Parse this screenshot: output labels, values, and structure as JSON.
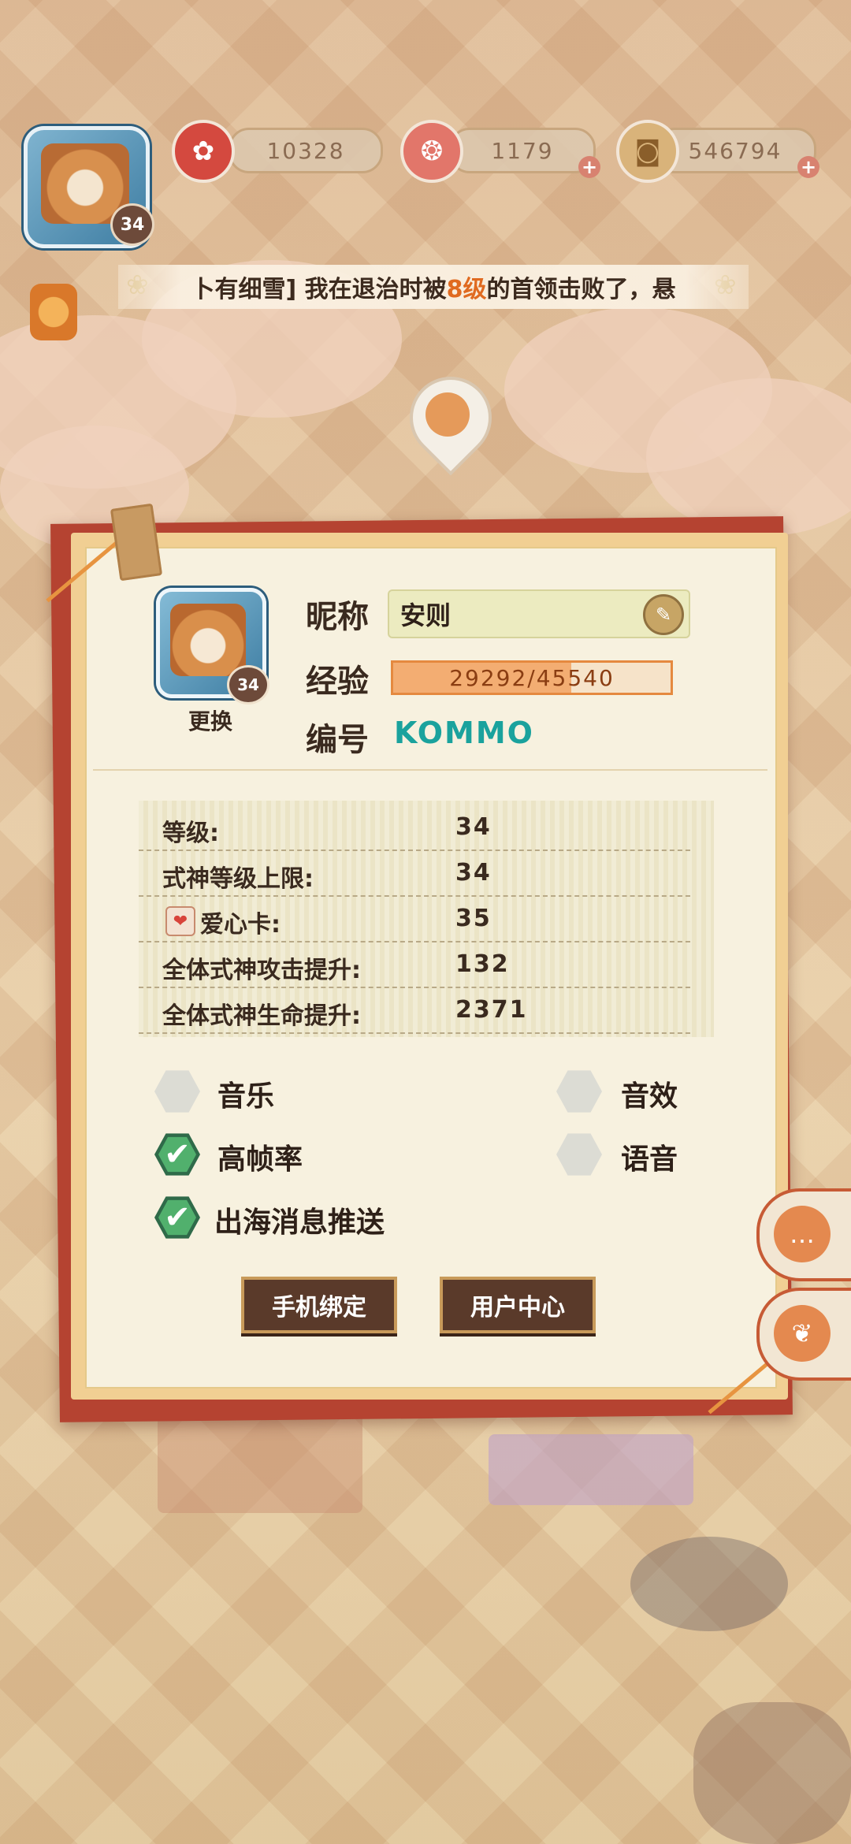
{
  "resources": {
    "magatama": "10328",
    "jade": "1179",
    "coins": "546794"
  },
  "top_avatar": {
    "level": "34"
  },
  "ticker": {
    "before": "卜有细雪] 我在退治时被",
    "highlight": "8级",
    "after": "的首领击败了，悬"
  },
  "profile": {
    "avatar_level": "34",
    "change_label": "更换",
    "nickname_label": "昵称",
    "nickname": "安则",
    "exp_label": "经验",
    "exp_text": "29292/45540",
    "exp_current": 29292,
    "exp_max": 45540,
    "id_label": "编号",
    "id_value": "KOMMO"
  },
  "stats": [
    {
      "label": "等级:",
      "value": "34"
    },
    {
      "label": "式神等级上限:",
      "value": "34"
    },
    {
      "label": "爱心卡:",
      "value": "35"
    },
    {
      "label": "全体式神攻击提升:",
      "value": "132"
    },
    {
      "label": "全体式神生命提升:",
      "value": "2371"
    }
  ],
  "settings": [
    {
      "label": "音乐",
      "checked": false
    },
    {
      "label": "音效",
      "checked": false
    },
    {
      "label": "高帧率",
      "checked": true
    },
    {
      "label": "语音",
      "checked": false
    },
    {
      "label": "出海消息推送",
      "checked": true
    }
  ],
  "buttons": {
    "bind_phone": "手机绑定",
    "user_center": "用户中心"
  },
  "icons": {
    "magatama": "plum-blossom-icon",
    "jade": "magatama-icon",
    "coin": "coin-icon",
    "plus": "plus-icon",
    "edit": "pencil-icon",
    "heart": "heart-card-icon",
    "chat": "chat-bubble-icon",
    "gift": "gift-icon"
  },
  "colors": {
    "panel_red": "#b54331",
    "exp_border": "#e5893f",
    "id_teal": "#1aa29d",
    "check_green": "#51b06d",
    "highlight_orange": "#e06a20"
  }
}
